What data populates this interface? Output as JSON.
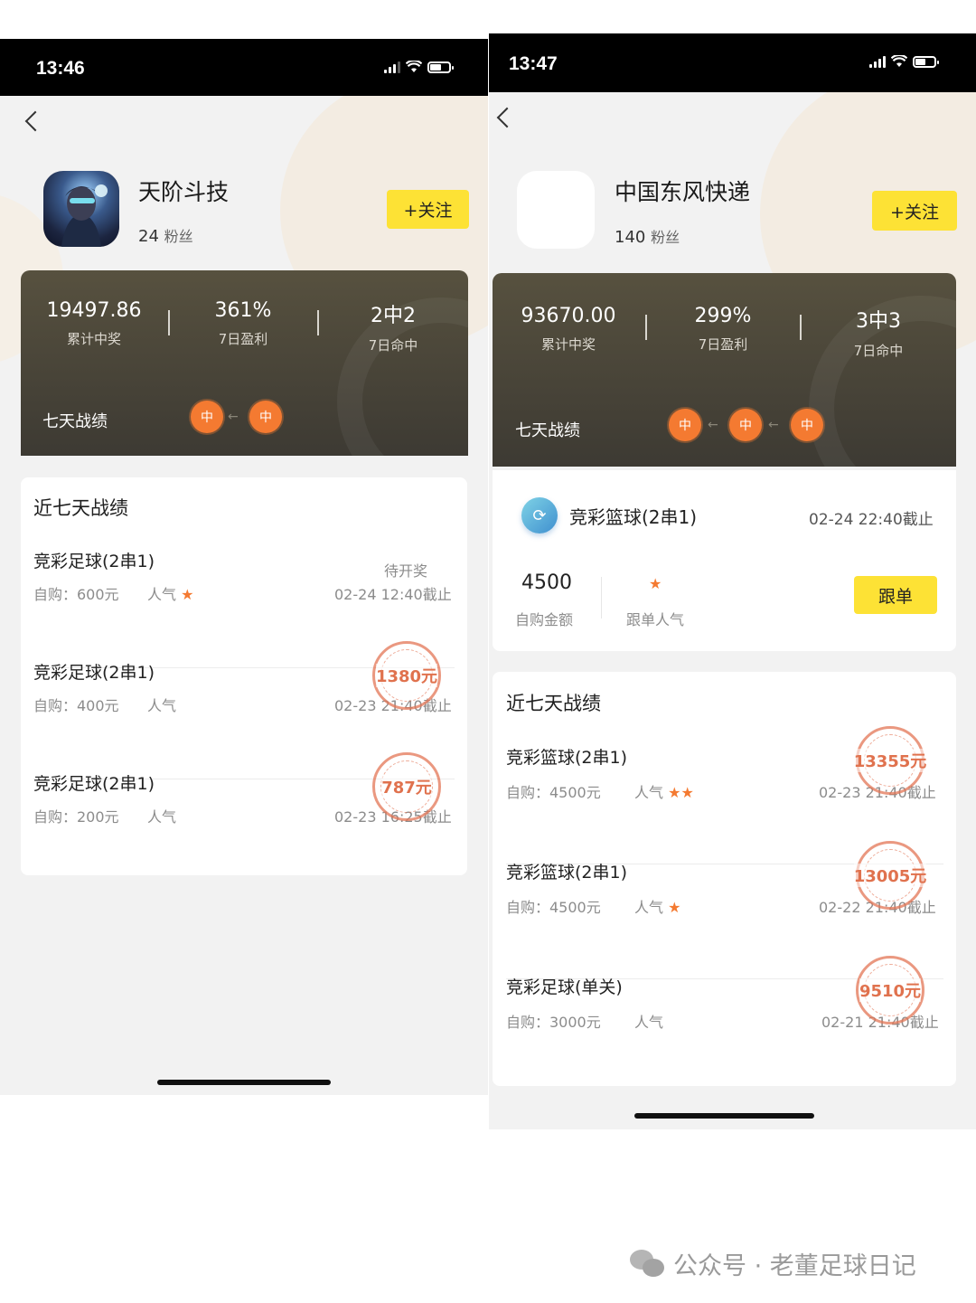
{
  "left": {
    "status_time": "13:46",
    "profile": {
      "name": "天阶斗技",
      "fans_count": "24",
      "fans_label": "粉丝",
      "follow_label": "+关注"
    },
    "stats": [
      {
        "value": "19497.86",
        "label": "累计中奖"
      },
      {
        "value": "361%",
        "label": "7日盈利"
      },
      {
        "value": "2中2",
        "label": "7日命中"
      }
    ],
    "seven_day_label": "七天战绩",
    "chips": [
      "中",
      "中"
    ],
    "arrow": "←",
    "records_title": "近七天战绩",
    "records": [
      {
        "title": "竞彩足球(2串1)",
        "buy": "自购：600元",
        "popularity": "人气",
        "stars": "★",
        "date": "02-24 12:40截止",
        "status": "待开奖",
        "stamp": ""
      },
      {
        "title": "竞彩足球(2串1)",
        "buy": "自购：400元",
        "popularity": "人气",
        "stars": "",
        "date": "02-23 21:40截止",
        "status": "",
        "stamp": "1380元"
      },
      {
        "title": "竞彩足球(2串1)",
        "buy": "自购：200元",
        "popularity": "人气",
        "stars": "",
        "date": "02-23 16:25截止",
        "status": "",
        "stamp": "787元"
      }
    ]
  },
  "right": {
    "status_time": "13:47",
    "profile": {
      "name": "中国东风快递",
      "fans_count": "140",
      "fans_label": "粉丝",
      "follow_label": "+关注"
    },
    "stats": [
      {
        "value": "93670.00",
        "label": "累计中奖"
      },
      {
        "value": "299%",
        "label": "7日盈利"
      },
      {
        "value": "3中3",
        "label": "7日命中"
      }
    ],
    "seven_day_label": "七天战绩",
    "chips": [
      "中",
      "中",
      "中"
    ],
    "arrow": "←",
    "current": {
      "title": "竞彩篮球(2串1)",
      "deadline": "02-24 22:40截止",
      "amount": "4500",
      "amount_label": "自购金额",
      "stars": "★",
      "popularity_label": "跟单人气",
      "follow_button": "跟单"
    },
    "records_title": "近七天战绩",
    "records": [
      {
        "title": "竞彩篮球(2串1)",
        "buy": "自购：4500元",
        "popularity": "人气",
        "stars": "★★",
        "date": "02-23 21:40截止",
        "stamp": "13355元"
      },
      {
        "title": "竞彩篮球(2串1)",
        "buy": "自购：4500元",
        "popularity": "人气",
        "stars": "★",
        "date": "02-22 21:40截止",
        "stamp": "13005元"
      },
      {
        "title": "竞彩足球(单关)",
        "buy": "自购：3000元",
        "popularity": "人气",
        "stars": "",
        "date": "02-21 21:40截止",
        "stamp": "9510元"
      }
    ]
  },
  "watermark": "公众号 · 老董足球日记",
  "colors": {
    "accent_yellow": "#fde235",
    "chip_orange": "#f47a31",
    "stamp_red": "#e0724e",
    "stats_bg": "#4a463b"
  }
}
